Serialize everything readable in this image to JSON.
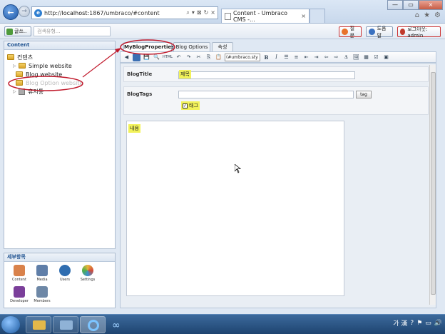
{
  "browser": {
    "url_prefix": "http://",
    "url_host": "localhost",
    "url_rest": ":1867/umbraco/#content",
    "tab_title": "Content - Umbraco CMS -...",
    "favicon": "e",
    "back_glyph": "←",
    "fwd_glyph": "→",
    "close_glyph": "×",
    "addr_icons": [
      "⌕",
      "▾",
      "⊠",
      "↻",
      "×"
    ],
    "right_icons": [
      "⌂",
      "★",
      "⚙"
    ],
    "window_buttons": [
      "—",
      "▭",
      "×"
    ]
  },
  "topbar": {
    "create_label": "글쓰..",
    "search_placeholder": "검색유형...",
    "help_label": "질문",
    "about_label": "도움말",
    "logout_label": "로그아웃: admin"
  },
  "left": {
    "header": "Content",
    "tree": [
      {
        "label": "컨텐츠"
      },
      {
        "label": "Simple website"
      },
      {
        "label": "Blog website"
      },
      {
        "label": "Blog Option website"
      },
      {
        "label": "휴지통"
      }
    ],
    "sections_header": "세부항목",
    "sections": [
      {
        "label": "Content",
        "color": "#d9824b"
      },
      {
        "label": "Media",
        "color": "#5f7ea8"
      },
      {
        "label": "Users",
        "color": "#2f6db0"
      },
      {
        "label": "Settings",
        "color": "#e9b43a"
      },
      {
        "label": "Developer",
        "color": "#7b3f9a"
      },
      {
        "label": "Members",
        "color": "#6d87a6"
      }
    ]
  },
  "main": {
    "tabs": [
      "MyBlogProperties",
      "Blog Options",
      "속성"
    ],
    "toolbar": {
      "style_select": "(#umbraco.sty",
      "bold": "B",
      "italic": "I",
      "html": "HTML",
      "icons": [
        "◀",
        "💾",
        "🖨",
        "🔍",
        "↶",
        "↷",
        "✂",
        "⎘",
        "📋",
        "☰",
        "≡",
        "⇤",
        "⇥",
        "⇦",
        "⇨",
        "⚓",
        "🖼",
        "▦",
        "☑",
        "▣"
      ]
    },
    "blog_title_label": "BlogTitle",
    "blog_title_value": "제목",
    "blog_tags_label": "BlogTags",
    "tag_button": "tag",
    "tag_checkbox_label": "태그",
    "body_label": "내용"
  },
  "taskbar": {
    "tray_text": "가 漢",
    "tray_icons": [
      "?",
      "⚑",
      "▭",
      "🔊"
    ]
  },
  "colors": {
    "accent": "#1b4f8e",
    "annotation": "#c0182a",
    "highlight": "#f2f25a"
  }
}
